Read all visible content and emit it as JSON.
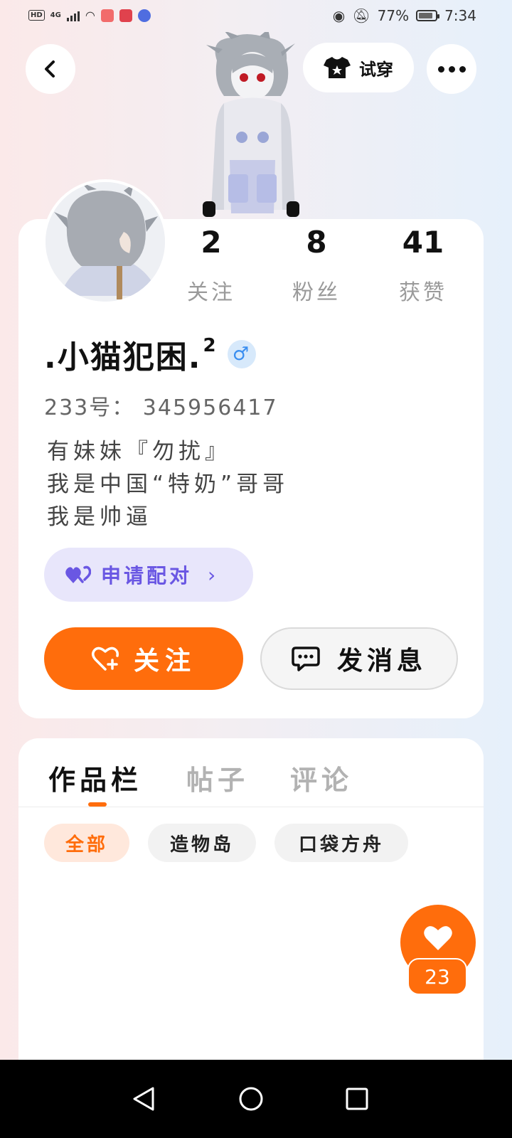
{
  "status_bar": {
    "network_badge": "HD",
    "network_type": "4G",
    "battery": "77%",
    "time": "7:34"
  },
  "header": {
    "try_on_label": "试穿",
    "icons": [
      "back-arrow-icon",
      "tshirt-icon",
      "more-dots-icon"
    ]
  },
  "profile": {
    "username": ".小猫犯困.",
    "username_sup": "2",
    "gender_symbol": "♂",
    "uid_text": "233号： 345956417",
    "bio": [
      "有妹妹『勿扰』",
      "我是中国“特奶”哥哥",
      "我是帅逼"
    ],
    "stats": [
      {
        "value": "2",
        "label": "关注"
      },
      {
        "value": "8",
        "label": "粉丝"
      },
      {
        "value": "41",
        "label": "获赞"
      }
    ],
    "pair_label": "申请配对",
    "follow_label": "关注",
    "message_label": "发消息"
  },
  "works": {
    "tabs": [
      "作品栏",
      "帖子",
      "评论"
    ],
    "active_tab": 0,
    "filters": [
      "全部",
      "造物岛",
      "口袋方舟"
    ],
    "active_filter": 0
  },
  "like_fab": {
    "count": "23"
  },
  "colors": {
    "accent": "#ff6d0c",
    "pair": "#6a57e3",
    "gender": "#3a8ef0"
  }
}
